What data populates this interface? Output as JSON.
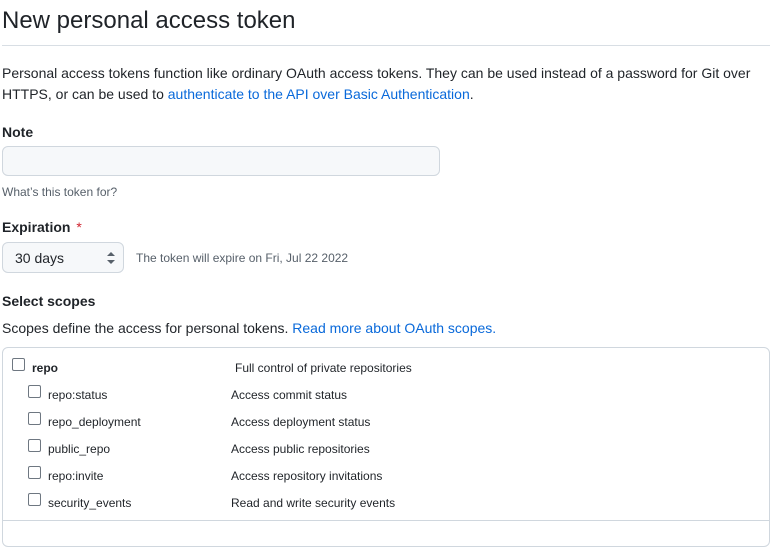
{
  "page": {
    "title": "New personal access token",
    "intro_text": "Personal access tokens function like ordinary OAuth access tokens. They can be used instead of a password for Git over HTTPS, or can be used to ",
    "intro_link": "authenticate to the API over Basic Authentication",
    "intro_end": "."
  },
  "note": {
    "label": "Note",
    "value": "",
    "placeholder": "",
    "hint": "What’s this token for?"
  },
  "expiration": {
    "label": "Expiration",
    "required_mark": "*",
    "selected": "30 days",
    "info": "The token will expire on Fri, Jul 22 2022"
  },
  "scopes": {
    "label": "Select scopes",
    "desc_text": "Scopes define the access for personal tokens. ",
    "desc_link": "Read more about OAuth scopes.",
    "items": [
      {
        "name": "repo",
        "desc": "Full control of private repositories",
        "parent": true
      },
      {
        "name": "repo:status",
        "desc": "Access commit status",
        "parent": false
      },
      {
        "name": "repo_deployment",
        "desc": "Access deployment status",
        "parent": false
      },
      {
        "name": "public_repo",
        "desc": "Access public repositories",
        "parent": false
      },
      {
        "name": "repo:invite",
        "desc": "Access repository invitations",
        "parent": false
      },
      {
        "name": "security_events",
        "desc": "Read and write security events",
        "parent": false
      }
    ]
  },
  "colors": {
    "link": "#0969da",
    "text": "#1f2328",
    "muted": "#57606a",
    "border": "#d0d7de",
    "required": "#cf222e",
    "input_bg": "#f6f8fa"
  }
}
